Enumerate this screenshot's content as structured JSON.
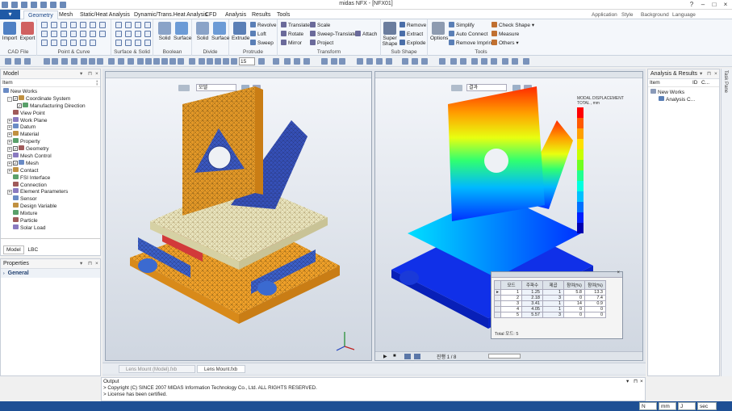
{
  "window": {
    "title": "midas NFX - [NFX01]"
  },
  "tabs": [
    {
      "label": "Geometry",
      "active": true
    },
    {
      "label": "Mesh"
    },
    {
      "label": "Static/Heat Analysis"
    },
    {
      "label": "Dynamic/Trans.Heat Analysis"
    },
    {
      "label": "CFD"
    },
    {
      "label": "Analysis"
    },
    {
      "label": "Results"
    },
    {
      "label": "Tools"
    }
  ],
  "tabbar_right": {
    "application": "Application",
    "style": "Style",
    "background": "Background",
    "language": "Language"
  },
  "ribbon": {
    "cad_file": {
      "label": "CAD File",
      "import": "Import",
      "export": "Export"
    },
    "point_curve": {
      "label": "Point & Curve"
    },
    "surface_solid": {
      "label": "Surface & Solid"
    },
    "boolean": {
      "label": "Boolean",
      "solid": "Solid",
      "surface": "Surface"
    },
    "divide": {
      "label": "Divide",
      "solid": "Solid",
      "surface": "Surface"
    },
    "protrude": {
      "label": "Protrude",
      "extrude": "Extrude",
      "revolve": "Revolve",
      "loft": "Loft",
      "sweep": "Sweep"
    },
    "transform": {
      "label": "Transform",
      "translate": "Translate",
      "rotate": "Rotate",
      "mirror": "Mirror",
      "scale": "Scale",
      "sweep_translate": "Sweep-Translate",
      "project": "Project",
      "attach": "Attach"
    },
    "sub_shape": {
      "label": "Sub Shape",
      "super_shape": "Super Shape",
      "remove": "Remove",
      "extract": "Extract",
      "explode": "Explode"
    },
    "tools": {
      "label": "Tools",
      "options": "Options",
      "simplify": "Simplify",
      "auto_connect": "Auto Connect",
      "remove_imprint": "Remove Imprint",
      "check_shape": "Check Shape",
      "measure": "Measure",
      "others": "Others"
    }
  },
  "toolbar": {
    "zoom_value": "15"
  },
  "model_panel": {
    "title": "Model",
    "column": "Item",
    "items": [
      {
        "label": "New Works",
        "indent": 0,
        "expander": "",
        "check": false
      },
      {
        "label": "Coordinate System",
        "indent": 1,
        "expander": "-",
        "check": true
      },
      {
        "label": "Manufacturing Direction",
        "indent": 2,
        "expander": "",
        "check": true
      },
      {
        "label": "View Point",
        "indent": 1,
        "expander": "",
        "check": false
      },
      {
        "label": "Work Plane",
        "indent": 1,
        "expander": "+",
        "check": false
      },
      {
        "label": "Datum",
        "indent": 1,
        "expander": "+",
        "check": false
      },
      {
        "label": "Material",
        "indent": 1,
        "expander": "+",
        "check": false
      },
      {
        "label": "Property",
        "indent": 1,
        "expander": "+",
        "check": false
      },
      {
        "label": "Geometry",
        "indent": 1,
        "expander": "+",
        "check": true
      },
      {
        "label": "Mesh Control",
        "indent": 1,
        "expander": "+",
        "check": false
      },
      {
        "label": "Mesh",
        "indent": 1,
        "expander": "+",
        "check": true
      },
      {
        "label": "Contact",
        "indent": 1,
        "expander": "+",
        "check": false
      },
      {
        "label": "FSI Interface",
        "indent": 1,
        "expander": "",
        "check": false
      },
      {
        "label": "Connection",
        "indent": 1,
        "expander": "",
        "check": false
      },
      {
        "label": "Element Parameters",
        "indent": 1,
        "expander": "+",
        "check": false
      },
      {
        "label": "Sensor",
        "indent": 1,
        "expander": "",
        "check": false
      },
      {
        "label": "Design Variable",
        "indent": 1,
        "expander": "",
        "check": false
      },
      {
        "label": "Mixture",
        "indent": 1,
        "expander": "",
        "check": false
      },
      {
        "label": "Particle",
        "indent": 1,
        "expander": "",
        "check": false
      },
      {
        "label": "Solar Load",
        "indent": 1,
        "expander": "",
        "check": false
      }
    ],
    "bottom_tabs": [
      "Model",
      "LBC"
    ]
  },
  "properties_panel": {
    "title": "Properties",
    "section": "General"
  },
  "results_panel": {
    "title": "Analysis & Results",
    "columns": [
      "Item",
      "ID",
      "C..."
    ],
    "items": [
      {
        "label": "New Works",
        "indent": 0
      },
      {
        "label": "Analysis C...",
        "indent": 1
      }
    ],
    "side_tab": "Task Pane"
  },
  "legend": {
    "title": "MODAL DISPLACEMENT",
    "subtitle": "TOTAL , mm",
    "colors": [
      "#ff0000",
      "#ff5a00",
      "#ffa000",
      "#ffe000",
      "#c8ff00",
      "#70ff20",
      "#20ff90",
      "#00ffe0",
      "#00c0ff",
      "#0070ff",
      "#0020ff",
      "#0000b0"
    ]
  },
  "freq_table": {
    "headers": [
      "모드",
      "주파수",
      "제곱",
      "참여(%)",
      "참여(%)"
    ],
    "rows": [
      {
        "mode": "1",
        "freq": "1.25",
        "a": "1",
        "b": "5.8",
        "c": "13.3"
      },
      {
        "mode": "2",
        "freq": "2.18",
        "a": "3",
        "b": "0",
        "c": "7.4"
      },
      {
        "mode": "3",
        "freq": "3.41",
        "a": "1",
        "b": "14",
        "c": "0.9"
      },
      {
        "mode": "4",
        "freq": "4.05",
        "a": "1",
        "b": "0",
        "c": "0"
      },
      {
        "mode": "5",
        "freq": "5.57",
        "a": "3",
        "b": "0",
        "c": "0"
      }
    ],
    "footer": "Total 모드: 5"
  },
  "viewport_tabs": [
    "Lens Mount (Model).fxb",
    "Lens Mount.fxb"
  ],
  "viewport_left_combo": "모델",
  "viewport_right_combo": "결과",
  "anim_label": "진행 1 / 8",
  "output": {
    "title": "Output",
    "lines": [
      "> Copyright (C) SINCE 2007 MIDAS Information Technology Co., Ltd. ALL RIGHTS RESERVED.",
      "> License has been certified."
    ]
  },
  "status": {
    "force": "N",
    "length": "mm",
    "energy": "J",
    "time": "sec"
  }
}
